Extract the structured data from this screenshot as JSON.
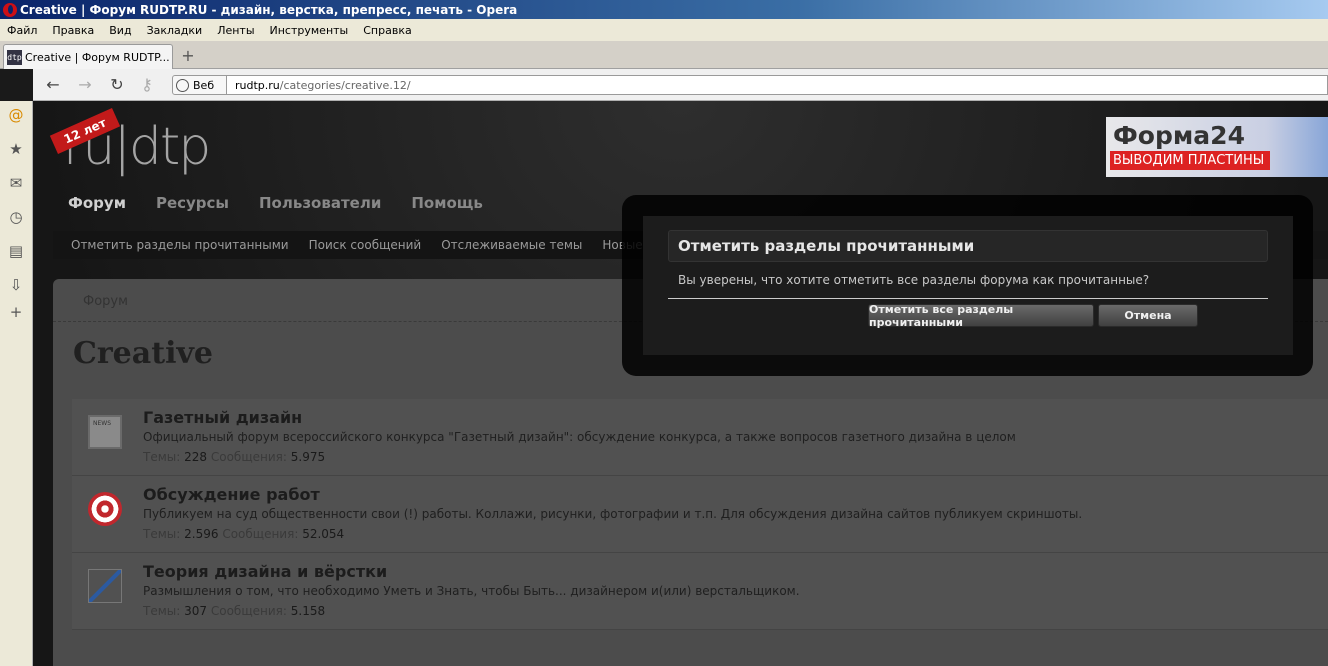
{
  "window": {
    "title": "Creative | Форум RUDTP.RU - дизайн, верстка, препресс, печать - Opera"
  },
  "menu": [
    "Файл",
    "Правка",
    "Вид",
    "Закладки",
    "Ленты",
    "Инструменты",
    "Справка"
  ],
  "tab": {
    "favicon": "dtp",
    "label": "Creative | Форум RUDTP..."
  },
  "nav": {
    "web_label": "Веб",
    "url_host": "rudtp.ru",
    "url_path": "/categories/creative.12/"
  },
  "site": {
    "logo_badge": "12 лет",
    "logo_text": "ru|dtp",
    "ad_title": "Форма24",
    "ad_subtitle": "ВЫВОДИМ ПЛАСТИНЫ",
    "mainnav": [
      "Форум",
      "Ресурсы",
      "Пользователи",
      "Помощь"
    ],
    "subnav": [
      "Отметить разделы прочитанными",
      "Поиск сообщений",
      "Отслеживаемые темы",
      "Новые сообщения"
    ],
    "breadcrumb": "Форум",
    "page_title": "Creative"
  },
  "forums": [
    {
      "title": "Газетный дизайн",
      "desc": "Официальный форум всероссийского конкурса \"Газетный дизайн\": обсуждение конкурса, а также вопросов газетного дизайна в целом",
      "threads_label": "Темы:",
      "threads": "228",
      "posts_label": "Сообщения:",
      "posts": "5.975"
    },
    {
      "title": "Обсуждение работ",
      "desc": "Публикуем на суд общественности свои (!) работы. Коллажи, рисунки, фотографии и т.п. Для обсуждения дизайна сайтов публикуем скриншоты.",
      "threads_label": "Темы:",
      "threads": "2.596",
      "posts_label": "Сообщения:",
      "posts": "52.054"
    },
    {
      "title": "Теория дизайна и вёрстки",
      "desc": "Размышления о том, что необходимо Уметь и Знать, чтобы Быть... дизайнером и(или) верстальщиком.",
      "threads_label": "Темы:",
      "threads": "307",
      "posts_label": "Сообщения:",
      "posts": "5.158"
    }
  ],
  "dialog": {
    "title": "Отметить разделы прочитанными",
    "text": "Вы уверены, что хотите отметить все разделы форума как прочитанные?",
    "confirm": "Отметить все разделы прочитанными",
    "cancel": "Отмена"
  }
}
